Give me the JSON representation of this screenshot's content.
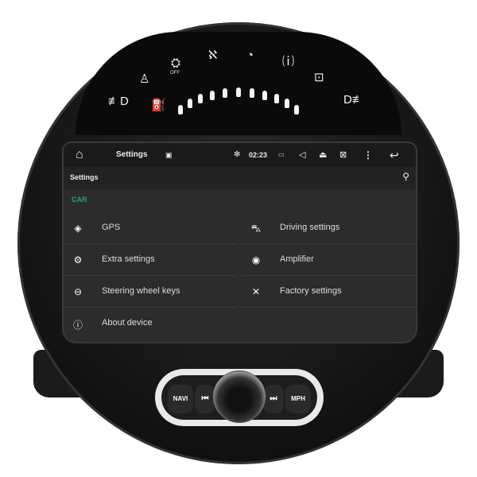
{
  "dashboard": {
    "icons": [
      "fog-light-front-icon",
      "seatbelt-icon",
      "airbag-off-icon",
      "airbag-icon",
      "tpms-icon",
      "engine-icon",
      "fuel-icon",
      "fog-light-rear-icon"
    ],
    "airbag_label": "OFF"
  },
  "status_bar": {
    "app_title": "Settings",
    "time": "02:23",
    "icons": [
      "home-icon",
      "image-icon",
      "bluetooth-icon",
      "battery-icon",
      "volume-icon",
      "eject-icon",
      "close-window-icon",
      "more-icon",
      "back-icon"
    ]
  },
  "title_bar": {
    "title": "Settings",
    "search_icon": "search-icon"
  },
  "section": "CAR",
  "items": [
    {
      "label": "GPS",
      "icon": "gps-icon"
    },
    {
      "label": "Driving settings",
      "icon": "car-icon"
    },
    {
      "label": "Extra settings",
      "icon": "gears-icon"
    },
    {
      "label": "Amplifier",
      "icon": "speaker-icon"
    },
    {
      "label": "Steering wheel keys",
      "icon": "steering-wheel-icon"
    },
    {
      "label": "Factory settings",
      "icon": "tools-icon"
    },
    {
      "label": "About device",
      "icon": "info-icon"
    }
  ],
  "controls": {
    "navi": "NAVI",
    "mph": "MPH",
    "accent": "#2a9d8f"
  }
}
